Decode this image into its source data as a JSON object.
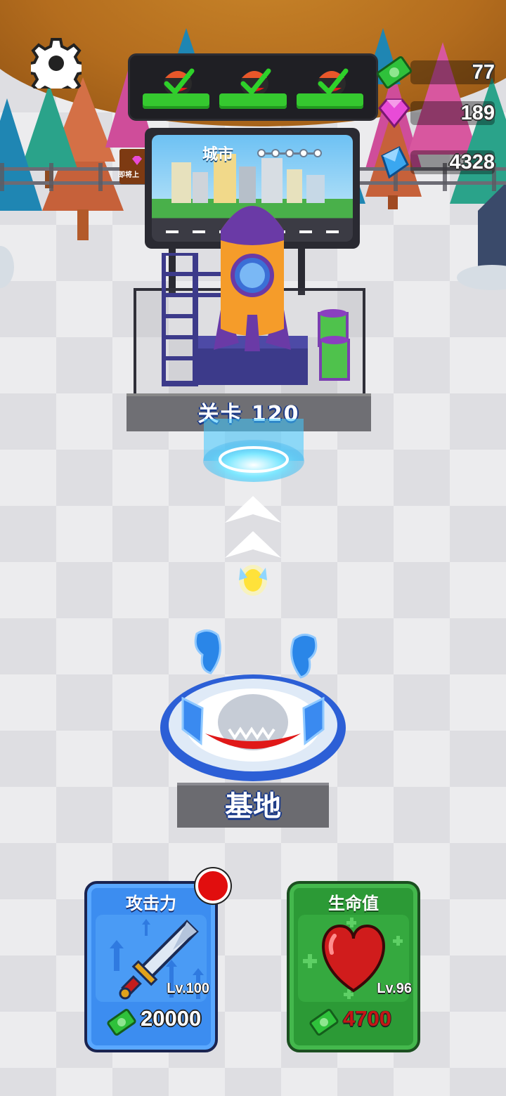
{
  "hud": {
    "resources": [
      {
        "name": "cash",
        "value": "77",
        "color": "#2fc13b"
      },
      {
        "name": "pink-gem",
        "value": "189",
        "color": "#e84bd7"
      },
      {
        "name": "blue-crystal",
        "value": "4328",
        "color": "#3aa7f0"
      }
    ],
    "progress_tasks": [
      {
        "state": "completed"
      },
      {
        "state": "completed"
      },
      {
        "state": "completed"
      }
    ]
  },
  "billboard": {
    "stage_name": "城市",
    "stage_dots": 5
  },
  "sign_text": "即将上",
  "level": {
    "label": "关卡 120"
  },
  "base": {
    "label": "基地"
  },
  "upgrades": {
    "attack": {
      "title": "攻击力",
      "level": "Lv.100",
      "cost": "20000",
      "has_notification": true,
      "color": "#3c8df0"
    },
    "health": {
      "title": "生命值",
      "level": "Lv.96",
      "cost": "4700",
      "cost_color": "#c41616",
      "color": "#2c9a36"
    }
  }
}
